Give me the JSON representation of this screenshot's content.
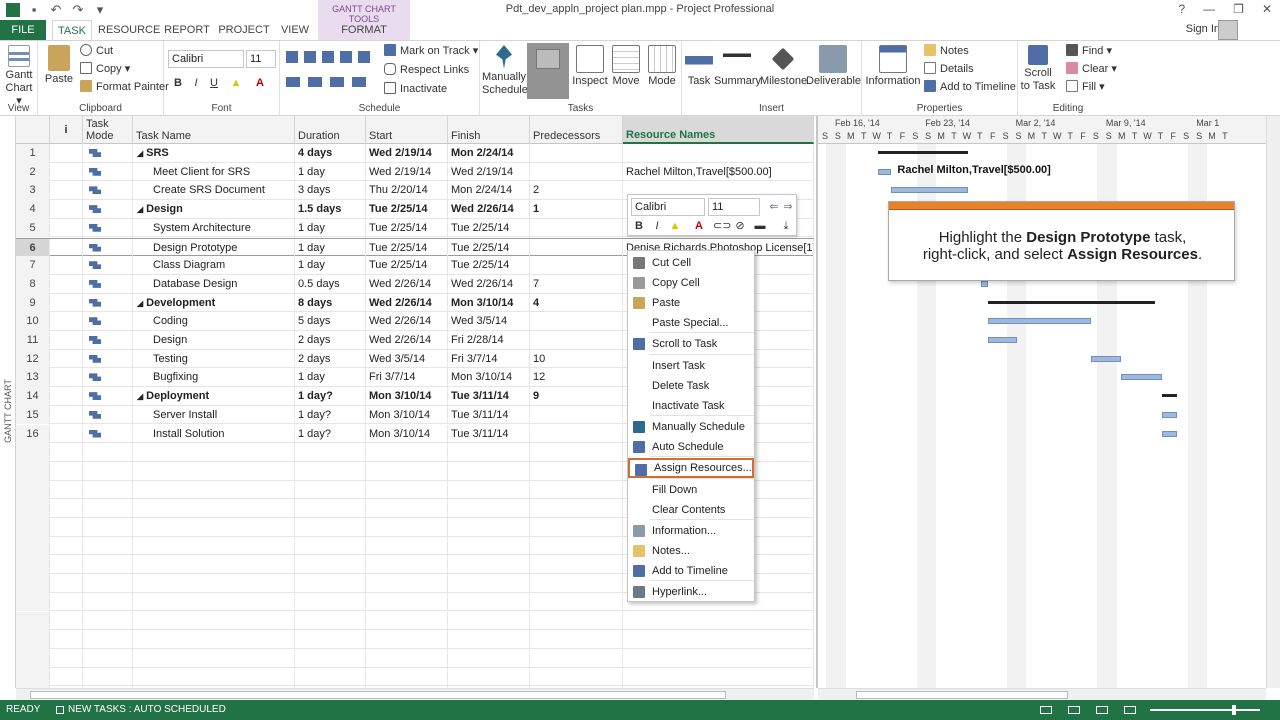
{
  "window": {
    "title": "Pdt_dev_appln_project plan.mpp - Project Professional",
    "context_group": "GANTT CHART TOOLS",
    "sign_in": "Sign In",
    "help": "?",
    "minimize": "—",
    "restore": "❐",
    "close": "✕"
  },
  "tabs": [
    "FILE",
    "TASK",
    "RESOURCE",
    "REPORT",
    "PROJECT",
    "VIEW",
    "FORMAT"
  ],
  "ribbon": {
    "view": {
      "gantt_chart": "Gantt Chart ▾",
      "label": "View"
    },
    "clipboard": {
      "paste": "Paste",
      "cut": "Cut",
      "copy": "Copy ▾",
      "format_painter": "Format Painter",
      "label": "Clipboard"
    },
    "font": {
      "family": "Calibri",
      "size": "11",
      "bold": "B",
      "italic": "I",
      "underline": "U",
      "label": "Font"
    },
    "schedule": {
      "mark_on_track": "Mark on Track ▾",
      "respect_links": "Respect Links",
      "inactivate": "Inactivate",
      "label": "Schedule"
    },
    "tasks": {
      "manually_schedule": "Manually Schedule",
      "inspect": "Inspect",
      "move": "Move",
      "mode": "Mode",
      "label": "Tasks"
    },
    "insert": {
      "task": "Task",
      "summary": "Summary",
      "milestone": "Milestone",
      "deliverable": "Deliverable",
      "label": "Insert"
    },
    "properties": {
      "information": "Information",
      "notes": "Notes",
      "details": "Details",
      "add_to_timeline": "Add to Timeline",
      "label": "Properties"
    },
    "editing": {
      "scroll_to_task": "Scroll to Task",
      "find": "Find ▾",
      "clear": "Clear ▾",
      "fill": "Fill ▾",
      "label": "Editing"
    }
  },
  "side_label": "GANTT CHART",
  "grid": {
    "headers": {
      "info": "i",
      "task_mode": "Task Mode",
      "task_name": "Task Name",
      "duration": "Duration",
      "start": "Start",
      "finish": "Finish",
      "predecessors": "Predecessors",
      "resource_names": "Resource Names"
    },
    "rows": [
      {
        "id": "1",
        "name": "SRS",
        "duration": "4 days",
        "start": "Wed 2/19/14",
        "finish": "Mon 2/24/14",
        "pred": "",
        "res": "",
        "summary": true,
        "indent": false
      },
      {
        "id": "2",
        "name": "Meet Client for SRS",
        "duration": "1 day",
        "start": "Wed 2/19/14",
        "finish": "Wed 2/19/14",
        "pred": "",
        "res": "Rachel Milton,Travel[$500.00]",
        "summary": false,
        "indent": true
      },
      {
        "id": "3",
        "name": "Create SRS Document",
        "duration": "3 days",
        "start": "Thu 2/20/14",
        "finish": "Mon 2/24/14",
        "pred": "2",
        "res": "",
        "summary": false,
        "indent": true
      },
      {
        "id": "4",
        "name": "Design",
        "duration": "1.5 days",
        "start": "Tue 2/25/14",
        "finish": "Wed 2/26/14",
        "pred": "1",
        "res": "",
        "summary": true,
        "indent": false
      },
      {
        "id": "5",
        "name": "System Architecture",
        "duration": "1 day",
        "start": "Tue 2/25/14",
        "finish": "Tue 2/25/14",
        "pred": "",
        "res": "",
        "summary": false,
        "indent": true
      },
      {
        "id": "6",
        "name": "Design Prototype",
        "duration": "1 day",
        "start": "Tue 2/25/14",
        "finish": "Tue 2/25/14",
        "pred": "",
        "res": "Denise Richards,Photoshop License[1]",
        "summary": false,
        "indent": true
      },
      {
        "id": "7",
        "name": "Class Diagram",
        "duration": "1 day",
        "start": "Tue 2/25/14",
        "finish": "Tue 2/25/14",
        "pred": "",
        "res": "",
        "summary": false,
        "indent": true
      },
      {
        "id": "8",
        "name": "Database Design",
        "duration": "0.5 days",
        "start": "Wed 2/26/14",
        "finish": "Wed 2/26/14",
        "pred": "7",
        "res": "",
        "summary": false,
        "indent": true
      },
      {
        "id": "9",
        "name": "Development",
        "duration": "8 days",
        "start": "Wed 2/26/14",
        "finish": "Mon 3/10/14",
        "pred": "4",
        "res": "",
        "summary": true,
        "indent": false
      },
      {
        "id": "10",
        "name": "Coding",
        "duration": "5 days",
        "start": "Wed 2/26/14",
        "finish": "Wed 3/5/14",
        "pred": "",
        "res": "",
        "summary": false,
        "indent": true
      },
      {
        "id": "11",
        "name": "Design",
        "duration": "2 days",
        "start": "Wed 2/26/14",
        "finish": "Fri 2/28/14",
        "pred": "",
        "res": "",
        "summary": false,
        "indent": true
      },
      {
        "id": "12",
        "name": "Testing",
        "duration": "2 days",
        "start": "Wed 3/5/14",
        "finish": "Fri 3/7/14",
        "pred": "10",
        "res": "",
        "summary": false,
        "indent": true
      },
      {
        "id": "13",
        "name": "Bugfixing",
        "duration": "1 day",
        "start": "Fri 3/7/14",
        "finish": "Mon 3/10/14",
        "pred": "12",
        "res": "",
        "summary": false,
        "indent": true
      },
      {
        "id": "14",
        "name": "Deployment",
        "duration": "1 day?",
        "start": "Mon 3/10/14",
        "finish": "Tue 3/11/14",
        "pred": "9",
        "res": "",
        "summary": true,
        "indent": false
      },
      {
        "id": "15",
        "name": "Server Install",
        "duration": "1 day?",
        "start": "Mon 3/10/14",
        "finish": "Tue 3/11/14",
        "pred": "",
        "res": "",
        "summary": false,
        "indent": true
      },
      {
        "id": "16",
        "name": "Install Solution",
        "duration": "1 day?",
        "start": "Mon 3/10/14",
        "finish": "Tue 3/11/14",
        "pred": "",
        "res": "",
        "summary": false,
        "indent": true
      }
    ],
    "selected_row": "6"
  },
  "gantt": {
    "weeks": [
      "Feb 16, '14",
      "Feb 23, '14",
      "Mar 2, '14",
      "Mar 9, '14",
      "Mar 1"
    ],
    "days": [
      "S",
      "S",
      "M",
      "T",
      "W",
      "T",
      "F",
      "S",
      "S",
      "M",
      "T",
      "W",
      "T",
      "F",
      "S",
      "S",
      "M",
      "T",
      "W",
      "T",
      "F",
      "S",
      "S",
      "M",
      "T",
      "W",
      "T",
      "F",
      "S",
      "S",
      "M",
      "T"
    ],
    "bar_label": "Rachel Milton,Travel[$500.00]"
  },
  "mini_toolbar": {
    "font": "Calibri",
    "size": "11",
    "bold": "B",
    "italic": "I"
  },
  "context_menu": {
    "items": [
      "Cut Cell",
      "Copy Cell",
      "Paste",
      "Paste Special...",
      "Scroll to Task",
      "Insert Task",
      "Delete Task",
      "Inactivate Task",
      "Manually Schedule",
      "Auto Schedule",
      "Assign Resources...",
      "Fill Down",
      "Clear Contents",
      "Information...",
      "Notes...",
      "Add to Timeline",
      "Hyperlink..."
    ],
    "highlighted": "Assign Resources..."
  },
  "callout": {
    "line1_pre": "Highlight the ",
    "line1_bold": "Design Prototype",
    "line1_post": " task,",
    "line2_pre": "right-click, and select ",
    "line2_bold": "Assign Resources",
    "line2_post": "."
  },
  "statusbar": {
    "ready": "READY",
    "new_tasks": "NEW TASKS : AUTO SCHEDULED"
  },
  "colors": {
    "accent": "#217346",
    "highlight": "#d86b2f",
    "bar": "#9fb9dd",
    "callout_bar": "#e8822a"
  }
}
